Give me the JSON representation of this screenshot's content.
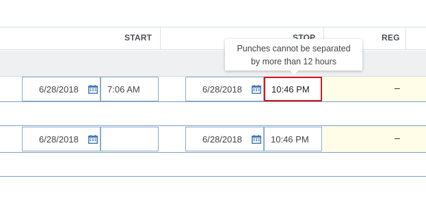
{
  "header": {
    "start_label": "START",
    "stop_label": "STOP",
    "reg_label": "REG"
  },
  "rows": [
    {
      "start_date": "6/28/2018",
      "start_time": "7:06 AM",
      "stop_date": "6/28/2018",
      "stop_time": "10:46 PM",
      "reg": "–",
      "stop_time_error": true
    },
    {
      "start_date": "6/28/2018",
      "start_time": "",
      "stop_date": "6/28/2018",
      "stop_time": "10:46 PM",
      "reg": "–",
      "stop_time_error": false
    }
  ],
  "tooltip": {
    "line1": "Punches cannot be separated",
    "line2": "by more than 12 hours"
  },
  "colors": {
    "error_border": "#d21a1a",
    "reg_background": "#fffde8",
    "row_divider": "#7a9fc4",
    "group_bar": "#eef0f2"
  },
  "icons": {
    "date_picker": "calendar-icon"
  }
}
